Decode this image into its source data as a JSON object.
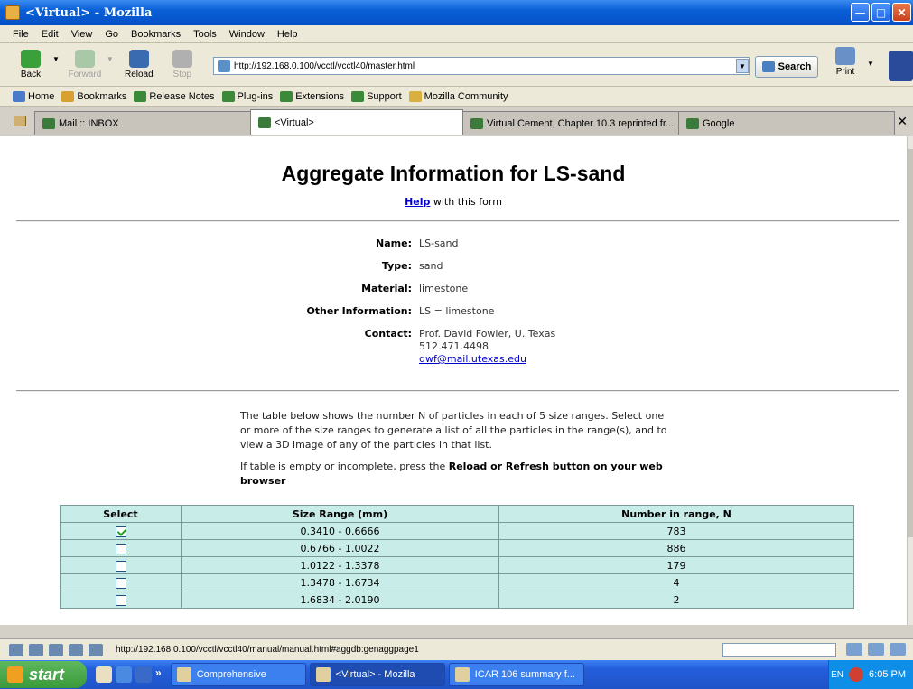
{
  "window": {
    "title": "<Virtual> - Mozilla"
  },
  "menu": [
    "File",
    "Edit",
    "View",
    "Go",
    "Bookmarks",
    "Tools",
    "Window",
    "Help"
  ],
  "nav": {
    "back": "Back",
    "forward": "Forward",
    "reload": "Reload",
    "stop": "Stop",
    "print": "Print",
    "search": "Search"
  },
  "url": "http://192.168.0.100/vcctl/vcctl40/master.html",
  "bookmarks": [
    "Home",
    "Bookmarks",
    "Release Notes",
    "Plug-ins",
    "Extensions",
    "Support",
    "Mozilla Community"
  ],
  "tabs": [
    "Mail :: INBOX",
    "<Virtual>",
    "Virtual Cement, Chapter 10.3 reprinted fr...",
    "Google"
  ],
  "page": {
    "title": "Aggregate Information for LS-sand",
    "help_link": "Help",
    "help_rest": " with this form",
    "name_label": "Name:",
    "name": "LS-sand",
    "type_label": "Type:",
    "type": "sand",
    "material_label": "Material:",
    "material": "limestone",
    "other_label": "Other Information:",
    "other": "LS = limestone",
    "contact_label": "Contact:",
    "contact_name": "Prof. David Fowler, U. Texas",
    "contact_phone": "512.471.4498",
    "contact_email": "dwf@mail.utexas.edu",
    "desc1": "The table below shows the number N of particles in each of 5 size ranges. Select one or more of the size ranges to generate a list of all the particles in the range(s), and to view a 3D image of any of the particles in that list.",
    "desc2_a": "If table is empty or incomplete, press the ",
    "desc2_b": "Reload or Refresh button on your web browser"
  },
  "table": {
    "headers": [
      "Select",
      "Size Range (mm)",
      "Number in range, N"
    ],
    "rows": [
      {
        "checked": true,
        "range": "0.3410 - 0.6666",
        "n": "783"
      },
      {
        "checked": false,
        "range": "0.6766 - 1.0022",
        "n": "886"
      },
      {
        "checked": false,
        "range": "1.0122 - 1.3378",
        "n": "179"
      },
      {
        "checked": false,
        "range": "1.3478 - 1.6734",
        "n": "4"
      },
      {
        "checked": false,
        "range": "1.6834 - 2.0190",
        "n": "2"
      }
    ]
  },
  "status": {
    "text": "http://192.168.0.100/vcctl/vcctl40/manual/manual.html#aggdb:genaggpage1"
  },
  "taskbar": {
    "start": "start",
    "more": "»",
    "tasks": [
      "Comprehensive",
      "<Virtual> - Mozilla",
      "ICAR 106 summary f..."
    ],
    "lang": "EN",
    "time": "6:05 PM"
  }
}
